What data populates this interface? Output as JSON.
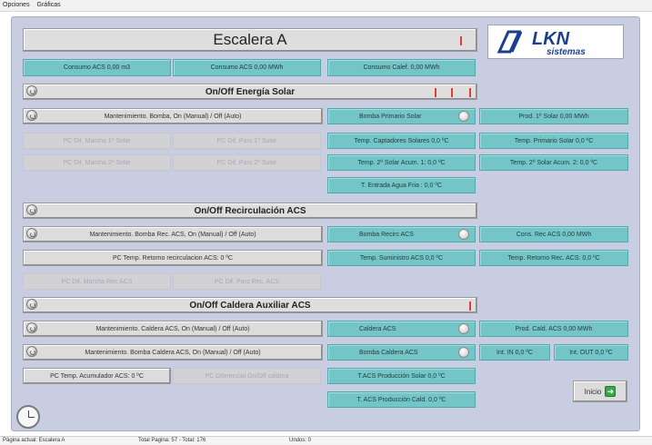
{
  "menu": [
    "Opciones",
    "Gráficas"
  ],
  "header": {
    "title": "Escalera A",
    "logo_text": "LKN",
    "logo_sub": "sistemas"
  },
  "consumos": [
    "Consumo ACS 0,00 m3",
    "Consumo ACS 0,00 MWh",
    "Consumo Calef. 0,00 MWh"
  ],
  "solar": {
    "title": "On/Off Energía Solar",
    "mant": "Mantenimiento. Bomba, On (Manual) / Off (Auto)",
    "pc": [
      "PC Dif. Marcha 1º Solar",
      "PC Dif. Paro 1º Solar",
      "PC Dif. Marcha 2º Solar",
      "PC Dif. Paro 2º Solar"
    ],
    "mid": [
      "Bomba Primario Solar",
      "Temp. Captadores Solares 0,0 ºC",
      "Temp. 2º Solar Acum. 1: 0,0 ºC",
      "T. Entrada Agua Fria : 0,0 ºC"
    ],
    "right": [
      "Prod. 1º Solar 0,00 MWh",
      "Temp. Primario Solar 0,0 ºC",
      "Temp. 2º Solar Acum. 2: 0,0 ºC"
    ]
  },
  "recirc": {
    "title": "On/Off Recirculación ACS",
    "mant": "Mantenimiento. Bomba Rec. ACS, On (Manual) / Off (Auto)",
    "pc_temp": "PC Temp. Retorno recirculacion ACS: 0 ºC",
    "pc": [
      "PC Dif. Marcha Rec ACS",
      "PC Dif. Paro Rec. ACS"
    ],
    "mid": [
      "Bomba Recirc ACS",
      "Temp. Suministro ACS 0,0 ºC"
    ],
    "right": [
      "Cons. Rec ACS 0,00 MWh",
      "Temp. Retorno Rec. ACS: 0,0 ºC"
    ]
  },
  "caldera": {
    "title": "On/Off Caldera Auxiliar ACS",
    "mant1": "Mantenimiento. Caldera ACS, On (Manual) / Off (Auto)",
    "mant2": "Mantenimiento. Bomba Caldera ACS, On (Manual) / Off (Auto)",
    "pc_temp": "PC Temp. Acumulador ACS: 0 ºC",
    "pc_dif": "PC Diferencial On/Off caldera",
    "mid": [
      "Caldera ACS",
      "Bomba Caldera ACS",
      "T.ACS Producción Solar 0,0 ºC",
      "T. ACS Producción Cald. 0,0 ºC"
    ],
    "right": [
      "Prod. Cald. ACS 0,00 MWh",
      "Int. IN 0,0 ºC",
      "Int. OUT 0,0 ºC"
    ]
  },
  "inicio": "Inicio",
  "status": {
    "pagina": "Página actual: Escalera A",
    "total": "Total Pagina: 57  -  Total: 176",
    "undos": "Undos: 0"
  },
  "colors": {
    "panel": "#c9cde1",
    "teal": "#74c5c7",
    "indicator_red": "#e23b3b",
    "logo_blue": "#1b3f8f"
  }
}
